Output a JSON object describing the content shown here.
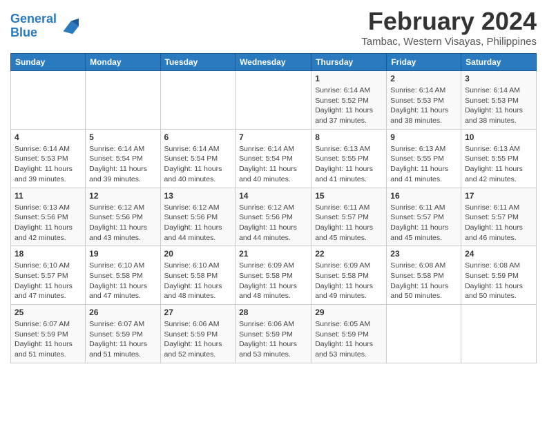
{
  "logo": {
    "line1": "General",
    "line2": "Blue"
  },
  "title": "February 2024",
  "location": "Tambac, Western Visayas, Philippines",
  "days_header": [
    "Sunday",
    "Monday",
    "Tuesday",
    "Wednesday",
    "Thursday",
    "Friday",
    "Saturday"
  ],
  "weeks": [
    [
      {
        "day": "",
        "info": ""
      },
      {
        "day": "",
        "info": ""
      },
      {
        "day": "",
        "info": ""
      },
      {
        "day": "",
        "info": ""
      },
      {
        "day": "1",
        "info": "Sunrise: 6:14 AM\nSunset: 5:52 PM\nDaylight: 11 hours\nand 37 minutes."
      },
      {
        "day": "2",
        "info": "Sunrise: 6:14 AM\nSunset: 5:53 PM\nDaylight: 11 hours\nand 38 minutes."
      },
      {
        "day": "3",
        "info": "Sunrise: 6:14 AM\nSunset: 5:53 PM\nDaylight: 11 hours\nand 38 minutes."
      }
    ],
    [
      {
        "day": "4",
        "info": "Sunrise: 6:14 AM\nSunset: 5:53 PM\nDaylight: 11 hours\nand 39 minutes."
      },
      {
        "day": "5",
        "info": "Sunrise: 6:14 AM\nSunset: 5:54 PM\nDaylight: 11 hours\nand 39 minutes."
      },
      {
        "day": "6",
        "info": "Sunrise: 6:14 AM\nSunset: 5:54 PM\nDaylight: 11 hours\nand 40 minutes."
      },
      {
        "day": "7",
        "info": "Sunrise: 6:14 AM\nSunset: 5:54 PM\nDaylight: 11 hours\nand 40 minutes."
      },
      {
        "day": "8",
        "info": "Sunrise: 6:13 AM\nSunset: 5:55 PM\nDaylight: 11 hours\nand 41 minutes."
      },
      {
        "day": "9",
        "info": "Sunrise: 6:13 AM\nSunset: 5:55 PM\nDaylight: 11 hours\nand 41 minutes."
      },
      {
        "day": "10",
        "info": "Sunrise: 6:13 AM\nSunset: 5:55 PM\nDaylight: 11 hours\nand 42 minutes."
      }
    ],
    [
      {
        "day": "11",
        "info": "Sunrise: 6:13 AM\nSunset: 5:56 PM\nDaylight: 11 hours\nand 42 minutes."
      },
      {
        "day": "12",
        "info": "Sunrise: 6:12 AM\nSunset: 5:56 PM\nDaylight: 11 hours\nand 43 minutes."
      },
      {
        "day": "13",
        "info": "Sunrise: 6:12 AM\nSunset: 5:56 PM\nDaylight: 11 hours\nand 44 minutes."
      },
      {
        "day": "14",
        "info": "Sunrise: 6:12 AM\nSunset: 5:56 PM\nDaylight: 11 hours\nand 44 minutes."
      },
      {
        "day": "15",
        "info": "Sunrise: 6:11 AM\nSunset: 5:57 PM\nDaylight: 11 hours\nand 45 minutes."
      },
      {
        "day": "16",
        "info": "Sunrise: 6:11 AM\nSunset: 5:57 PM\nDaylight: 11 hours\nand 45 minutes."
      },
      {
        "day": "17",
        "info": "Sunrise: 6:11 AM\nSunset: 5:57 PM\nDaylight: 11 hours\nand 46 minutes."
      }
    ],
    [
      {
        "day": "18",
        "info": "Sunrise: 6:10 AM\nSunset: 5:57 PM\nDaylight: 11 hours\nand 47 minutes."
      },
      {
        "day": "19",
        "info": "Sunrise: 6:10 AM\nSunset: 5:58 PM\nDaylight: 11 hours\nand 47 minutes."
      },
      {
        "day": "20",
        "info": "Sunrise: 6:10 AM\nSunset: 5:58 PM\nDaylight: 11 hours\nand 48 minutes."
      },
      {
        "day": "21",
        "info": "Sunrise: 6:09 AM\nSunset: 5:58 PM\nDaylight: 11 hours\nand 48 minutes."
      },
      {
        "day": "22",
        "info": "Sunrise: 6:09 AM\nSunset: 5:58 PM\nDaylight: 11 hours\nand 49 minutes."
      },
      {
        "day": "23",
        "info": "Sunrise: 6:08 AM\nSunset: 5:58 PM\nDaylight: 11 hours\nand 50 minutes."
      },
      {
        "day": "24",
        "info": "Sunrise: 6:08 AM\nSunset: 5:59 PM\nDaylight: 11 hours\nand 50 minutes."
      }
    ],
    [
      {
        "day": "25",
        "info": "Sunrise: 6:07 AM\nSunset: 5:59 PM\nDaylight: 11 hours\nand 51 minutes."
      },
      {
        "day": "26",
        "info": "Sunrise: 6:07 AM\nSunset: 5:59 PM\nDaylight: 11 hours\nand 51 minutes."
      },
      {
        "day": "27",
        "info": "Sunrise: 6:06 AM\nSunset: 5:59 PM\nDaylight: 11 hours\nand 52 minutes."
      },
      {
        "day": "28",
        "info": "Sunrise: 6:06 AM\nSunset: 5:59 PM\nDaylight: 11 hours\nand 53 minutes."
      },
      {
        "day": "29",
        "info": "Sunrise: 6:05 AM\nSunset: 5:59 PM\nDaylight: 11 hours\nand 53 minutes."
      },
      {
        "day": "",
        "info": ""
      },
      {
        "day": "",
        "info": ""
      }
    ]
  ]
}
